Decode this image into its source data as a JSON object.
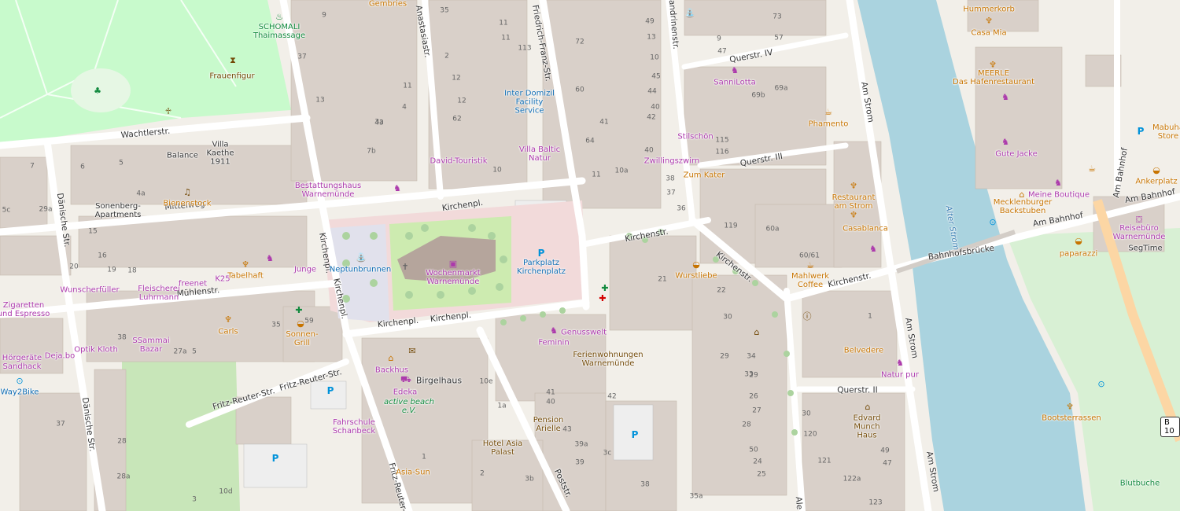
{
  "map": {
    "colors": {
      "background": "#f2efe9",
      "building": "#d9d0c9",
      "road": "#ffffff",
      "road_casing": "#c9b7b7",
      "park": "#c8facc",
      "water": "#aad3df",
      "square": "#f2dada",
      "poi": "#ac39ac",
      "food": "#c77400",
      "amenity": "#0092da"
    },
    "streets": {
      "wachtlerstr": "Wachtlerstr.",
      "mittelweg": "Mittelweg",
      "muehlenstr": "Mühlenstr.",
      "kirchenpl_top": "Kirchenpl.",
      "kirchenpl_bottom": "Kirchenpl.",
      "kirchenpl_bottom2": "Kirchenpl.",
      "kirchenpl_left": "Kirchenpl.",
      "kirchenpl_left2": "Kirchenpl.",
      "kirchenstr_1": "Kirchenstr.",
      "kirchenstr_2": "Kirchenstr.",
      "kirchenstr_3": "Kirchenstr.",
      "querstr_iv": "Querstr. IV",
      "querstr_iii": "Querstr. III",
      "querstr_ii": "Querstr. II",
      "am_strom_1": "Am Strom",
      "am_strom_2": "Am Strom",
      "am_strom_3": "Am Strom",
      "bahnhofsbruecke": "Bahnhofsbrücke",
      "am_bahnhof_1": "Am Bahnhof",
      "am_bahnhof_2": "Am Bahnhof",
      "am_bahnhof_v": "Am Bahnhof",
      "daenische_1": "Dänische Str.",
      "daenische_2": "Dänische Str.",
      "anastasiastr": "Anastasiastr.",
      "friedrich_franz": "Friedrich-Franz-Str.",
      "fritz_reuter_1": "Fritz-Reuter-Str.",
      "fritz_reuter_2": "Fritz-Reuter-Str.",
      "fritz_reuter_v": "Fritz-Reuter-",
      "poststr": "Poststr.",
      "alexandrinenstr": "Alexandrinenstr.",
      "alexandrinenstr_bottom": "Ale",
      "alter_strom": "Alter Strom"
    },
    "pois": {
      "gembries": "Gembries",
      "schomali": "SCHOMALI\nThaimassage",
      "frauenfigur": "Frauenfigur",
      "villa_kaethe": "Villa\nKaethe\n1911",
      "balance": "Balance",
      "sonenberg": "Sonenberg-\nApartments",
      "bienenstock": "Bienenstock",
      "bestattungshaus": "Bestattungshaus\nWarnemünde",
      "david": "David-Touristik",
      "inter_domizil": "Inter Domizil\nFacility\nService",
      "villa_baltic": "Villa Baltic\nNatur",
      "stilschoen": "Stilschön",
      "zwillingszwirn": "Zwillingszwirn",
      "sannilotta": "SanniLotta",
      "phamento": "Phamento",
      "zum_kater": "Zum Kater",
      "restaurant_strom": "Restaurant\nam Strom",
      "casablanca": "Casablanca",
      "mahlwerk": "Mahlwerk\nCoffee",
      "wurstliebe": "Wurstliebe",
      "neptunbrunnen": "Neptunbrunnen",
      "wochenmarkt": "Wochenmarkt\nWarnemünde",
      "parkplatz": "Parkplatz\nKirchenplatz",
      "junge": "Junge",
      "wunschfueller": "Wunscherfüller",
      "fleischerei": "Fleischerei\nLuhrmann",
      "freenet": "freenet",
      "k25": "K25",
      "tabelhaft": "Tabelhaft",
      "zigaretten": "Zigaretten\nund Espresso",
      "optik": "Optik Kloth",
      "ssammai": "SSammai\nBazar",
      "carls": "Carls",
      "sonnengrill": "Sonnen-\nGrill",
      "hoergeraete": "Hörgeräte\nSandhack",
      "dejabo": "Deja.bo",
      "way2bike": "Way2Bike",
      "backhus": "Backhus",
      "edeka": "Edeka",
      "active_beach": "active beach\ne.V.",
      "birgelhaus": "Birgelhaus",
      "fahrschule": "Fahrschule\nSchanbeck",
      "feminin": "Feminin",
      "genusswelt": "Genusswelt",
      "ferienwohnungen": "Ferienwohnungen\nWarnemünde",
      "pension": "Pension\nArielle",
      "hotel_asia": "Hotel Asia\nPalast",
      "asia_sun": "Asia-Sun",
      "belvedere": "Belvedere",
      "natur_pur": "Natur pur",
      "edvard": "Edvard\nMunch\nHaus",
      "hummerkorb": "Hummerkorb",
      "casa_mia": "Casa Mia",
      "meerle": "MEERLE\nDas Hafenrestaurant",
      "gute_jacke": "Gute Jacke",
      "meine_boutique": "Meine Boutique",
      "mecklenburger": "Mecklenburger\nBackstuben",
      "ankerplatz": "Ankerplatz",
      "mabuhay": "Mabuha\nStore",
      "reisebuero": "Reisebüro\nWarnemünde",
      "segtime": "SegTime",
      "paparazzi": "paparazzi",
      "bootsterrassen": "Bootsterrassen",
      "blutbuche": "Blutbuche"
    },
    "road_shield": "B 10",
    "house_numbers": [
      "9",
      "35",
      "11",
      "49",
      "73",
      "11",
      "13",
      "9",
      "57",
      "113",
      "72",
      "2",
      "10",
      "37",
      "47",
      "12",
      "11",
      "45",
      "69b",
      "69a",
      "13",
      "12",
      "60",
      "44",
      "43",
      "4",
      "40",
      "62",
      "42",
      "41",
      "3a",
      "64",
      "40",
      "115",
      "116",
      "7b",
      "10",
      "11",
      "10a",
      "38",
      "37",
      "36",
      "7",
      "6",
      "5",
      "4a",
      "29a",
      "5c",
      "119",
      "60a",
      "60/61",
      "15",
      "16",
      "19",
      "18",
      "20",
      "21",
      "22",
      "1",
      "35",
      "59",
      "27a",
      "5",
      "30",
      "29",
      "33",
      "41",
      "40",
      "42",
      "43",
      "39a",
      "39",
      "38",
      "37",
      "28",
      "28a",
      "3",
      "10d",
      "10e",
      "1a",
      "1",
      "2",
      "3b",
      "3c",
      "38",
      "35a",
      "34",
      "30",
      "120",
      "121",
      "122a",
      "123",
      "47",
      "49",
      "50",
      "24",
      "25",
      "26",
      "27",
      "28",
      "29",
      "23"
    ]
  }
}
